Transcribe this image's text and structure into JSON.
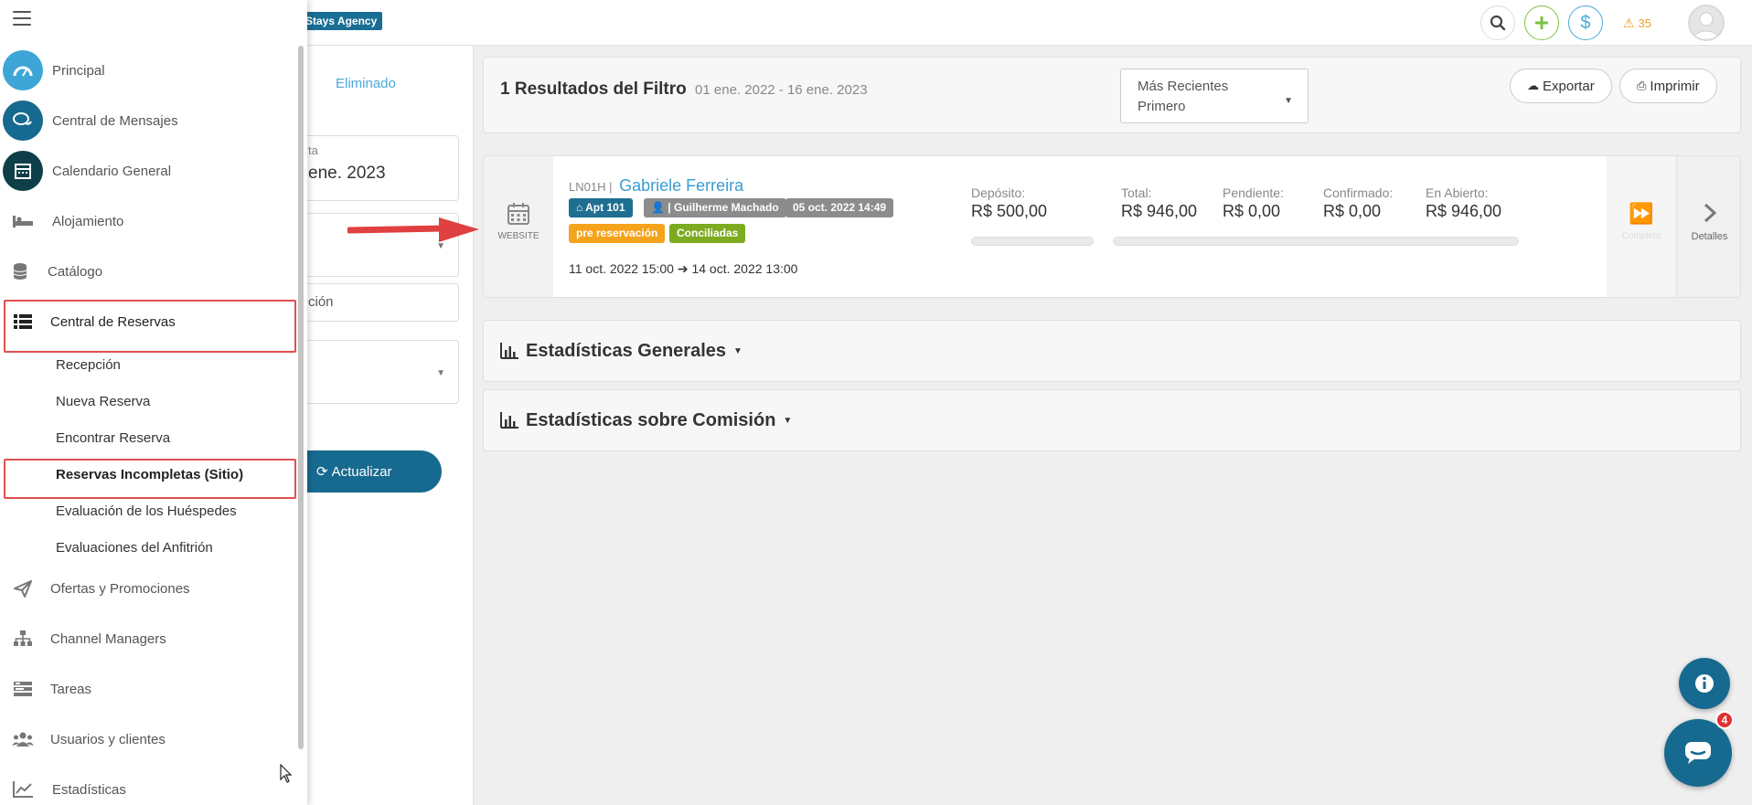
{
  "header": {
    "brand_badge": "Stays Agency",
    "warning_count": "35"
  },
  "filters": {
    "eliminado_link": "Eliminado",
    "date_label": "ta",
    "date_value": "ene. 2023",
    "field_text": "ción",
    "update_button": "Actualizar"
  },
  "sidebar": {
    "items": [
      {
        "label": "Principal"
      },
      {
        "label": "Central de Mensajes"
      },
      {
        "label": "Calendario General"
      },
      {
        "label": "Alojamiento"
      },
      {
        "label": "Catálogo"
      },
      {
        "label": "Central de Reservas"
      },
      {
        "label": "Ofertas y Promociones"
      },
      {
        "label": "Channel Managers"
      },
      {
        "label": "Tareas"
      },
      {
        "label": "Usuarios y clientes"
      },
      {
        "label": "Estadísticas"
      }
    ],
    "sub_items": [
      {
        "label": "Recepción"
      },
      {
        "label": "Nueva Reserva"
      },
      {
        "label": "Encontrar Reserva"
      },
      {
        "label": "Reservas Incompletas (Sitio)"
      },
      {
        "label": "Evaluación de los Huéspedes"
      },
      {
        "label": "Evaluaciones del Anfitrión"
      }
    ]
  },
  "results": {
    "title": "1 Resultados del Filtro",
    "date_range": "01 ene. 2022 - 16 ene. 2023",
    "sort_line1": "Más Recientes",
    "sort_line2": "Primero",
    "export_button": "Exportar",
    "print_button": "Imprimir"
  },
  "booking": {
    "source_label": "WEBSITE",
    "code": "LN01H |",
    "guest_name": "Gabriele Ferreira",
    "tag_apartment": "Apt 101",
    "tag_agent": "| Guilherme Machado",
    "tag_created": "05 oct. 2022 14:49",
    "tag_status": "pre reservación",
    "tag_reconciled": "Conciliadas",
    "checkin": "11 oct. 2022 15:00",
    "checkout": "14 oct. 2022 13:00",
    "deposit_label": "Depósito:",
    "deposit_value": "R$ 500,00",
    "total_label": "Total:",
    "total_value": "R$ 946,00",
    "pending_label": "Pendiente:",
    "pending_value": "R$ 0,00",
    "confirmed_label": "Confirmado:",
    "confirmed_value": "R$ 0,00",
    "open_label": "En Abierto:",
    "open_value": "R$ 946,00",
    "complete_label": "Completo",
    "details_label": "Detalles",
    "colors": {
      "apartment": "#1f6f93",
      "agent": "#8c8c8c",
      "status": "#f5a31a",
      "reconciled": "#7cab1f"
    }
  },
  "stats": {
    "general": "Estadísticas Generales",
    "commission": "Estadísticas sobre Comisión"
  },
  "chat": {
    "badge_count": "4"
  }
}
